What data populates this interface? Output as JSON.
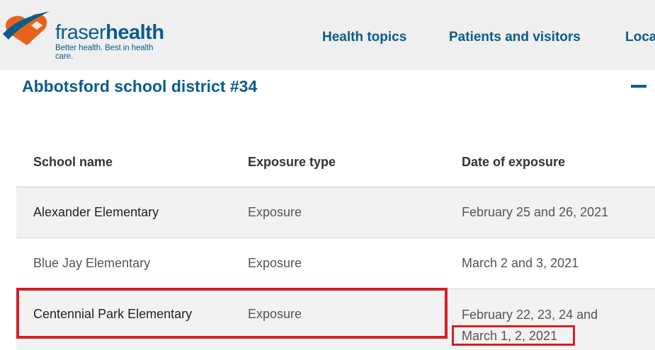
{
  "brand": {
    "name_part1": "fraser",
    "name_part2": "health",
    "tagline": "Better health. Best in health care.",
    "colors": {
      "primary": "#0b5c8a",
      "accent_orange": "#e8621c",
      "highlight_red": "#d42027"
    }
  },
  "nav": {
    "items": [
      "Health topics",
      "Patients and visitors",
      "Loca"
    ]
  },
  "section": {
    "title": "Abbotsford school district #34",
    "collapse_icon": "minus-icon"
  },
  "table": {
    "headers": [
      "School name",
      "Exposure type",
      "Date of exposure"
    ],
    "rows": [
      {
        "school": "Alexander Elementary",
        "type": "Exposure",
        "date": "February 25 and 26, 2021"
      },
      {
        "school": "Blue Jay Elementary",
        "type": "Exposure",
        "date": "March 2 and 3, 2021"
      },
      {
        "school": "Centennial Park Elementary",
        "type": "Exposure",
        "date_line1": "February 22, 23, 24 and",
        "date_line2": "March 1, 2, 2021"
      }
    ]
  }
}
